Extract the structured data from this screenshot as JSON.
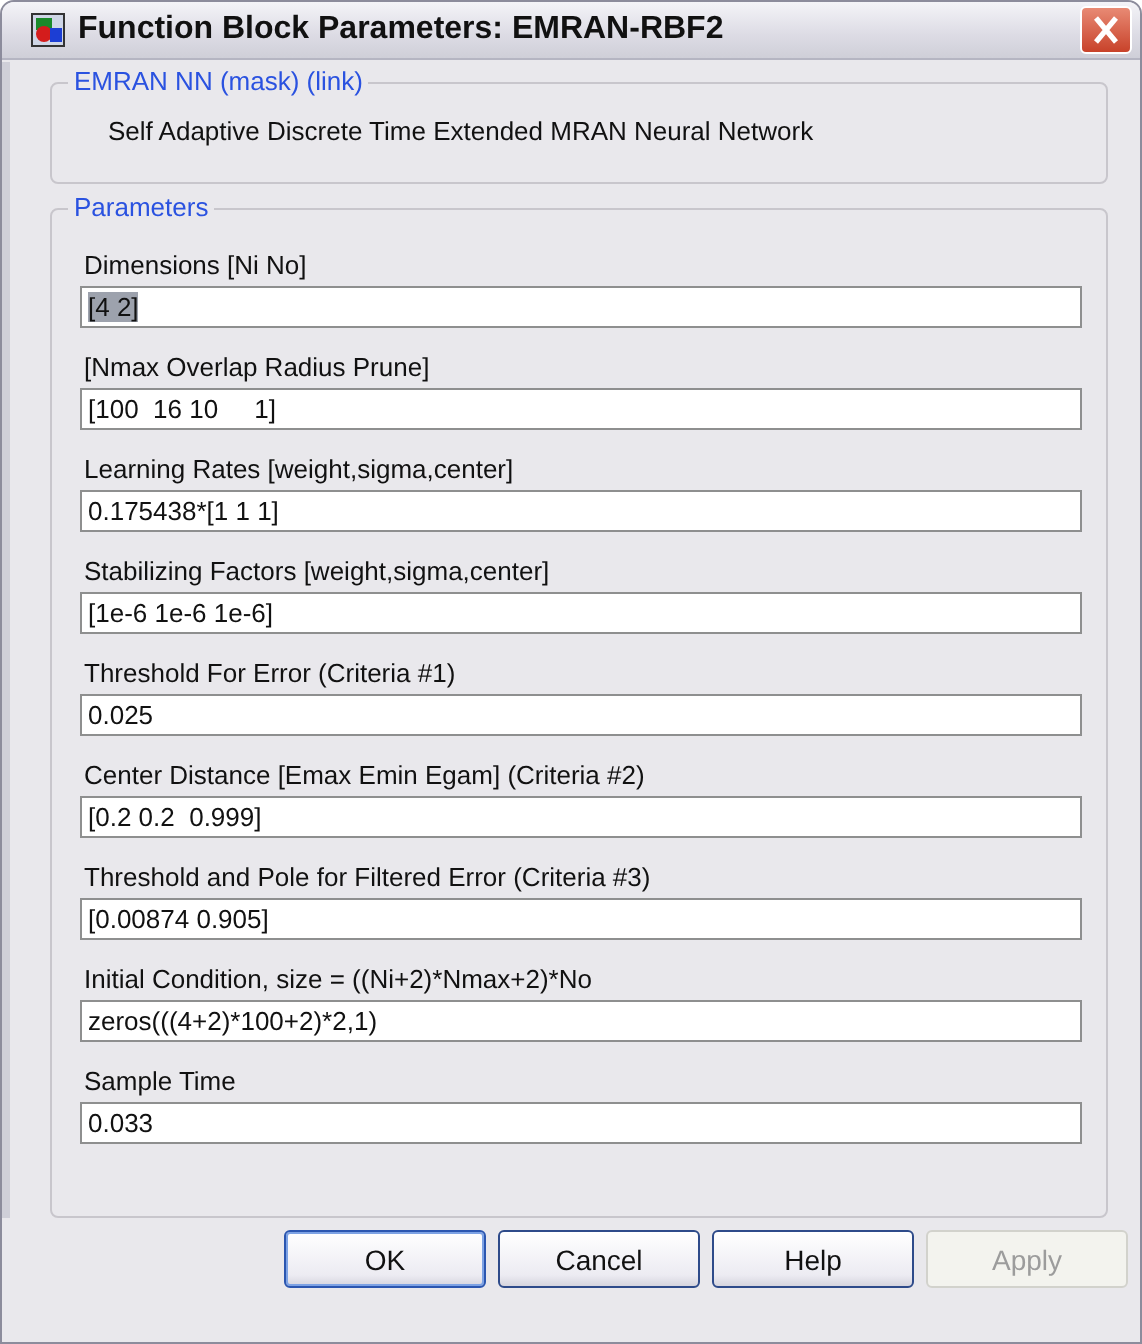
{
  "window": {
    "title": "Function Block Parameters: EMRAN-RBF2"
  },
  "description_group": {
    "title": "EMRAN NN (mask) (link)",
    "text": "Self Adaptive Discrete Time Extended MRAN Neural Network"
  },
  "parameters_group": {
    "title": "Parameters",
    "fields": [
      {
        "label": "Dimensions [Ni No]",
        "value": "[4 2]",
        "text_selected": true
      },
      {
        "label": "[Nmax Overlap Radius Prune]",
        "value": "[100  16 10     1]",
        "text_selected": false
      },
      {
        "label": "Learning Rates [weight,sigma,center]",
        "value": "0.175438*[1 1 1]",
        "text_selected": false
      },
      {
        "label": "Stabilizing Factors [weight,sigma,center]",
        "value": "[1e-6 1e-6 1e-6]",
        "text_selected": false
      },
      {
        "label": "Threshold For Error (Criteria #1)",
        "value": "0.025",
        "text_selected": false
      },
      {
        "label": "Center Distance [Emax Emin Egam] (Criteria #2)",
        "value": "[0.2 0.2  0.999]",
        "text_selected": false
      },
      {
        "label": "Threshold and Pole for Filtered Error (Criteria #3)",
        "value": "[0.00874 0.905]",
        "text_selected": false
      },
      {
        "label": "Initial Condition, size = ((Ni+2)*Nmax+2)*No",
        "value": "zeros(((4+2)*100+2)*2,1)",
        "text_selected": false
      },
      {
        "label": "Sample Time",
        "value": "0.033",
        "text_selected": false
      }
    ]
  },
  "buttons": [
    {
      "label": "OK",
      "disabled": false,
      "default": true
    },
    {
      "label": "Cancel",
      "disabled": false,
      "default": false
    },
    {
      "label": "Help",
      "disabled": false,
      "default": false
    },
    {
      "label": "Apply",
      "disabled": true,
      "default": false
    }
  ]
}
